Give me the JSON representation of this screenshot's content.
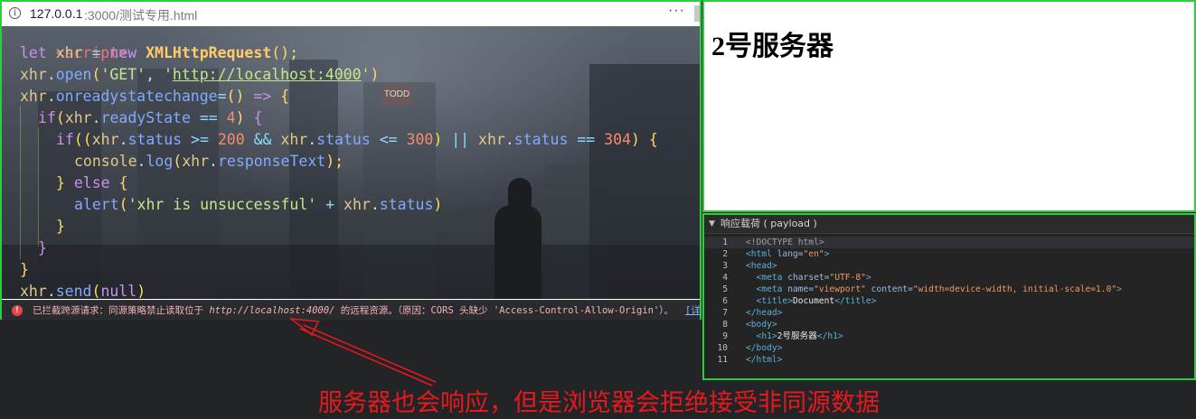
{
  "browser": {
    "url_host": "127.0.0.1",
    "url_rest": ":3000/测试专用.html",
    "info_icon": "i",
    "menu_icon": "···"
  },
  "code": {
    "partial_top": "<script>",
    "lines": [
      {
        "indent": 1,
        "tokens": [
          {
            "t": "let ",
            "c": "kw"
          },
          {
            "t": "xhr",
            "c": "var"
          },
          {
            "t": " = ",
            "c": "op"
          },
          {
            "t": "new ",
            "c": "kw"
          },
          {
            "t": "XMLHttpRequest",
            "c": "cls"
          },
          {
            "t": "();",
            "c": "pn"
          }
        ]
      },
      {
        "indent": 1,
        "tokens": [
          {
            "t": "xhr",
            "c": "var"
          },
          {
            "t": ".",
            "c": "pl"
          },
          {
            "t": "open",
            "c": "fn"
          },
          {
            "t": "(",
            "c": "pn"
          },
          {
            "t": "'GET'",
            "c": "str"
          },
          {
            "t": ", ",
            "c": "pl"
          },
          {
            "t": "'",
            "c": "str"
          },
          {
            "t": "http://localhost:4000",
            "c": "url"
          },
          {
            "t": "'",
            "c": "str"
          },
          {
            "t": ")",
            "c": "pn"
          }
        ]
      },
      {
        "indent": 1,
        "tokens": [
          {
            "t": "xhr",
            "c": "var"
          },
          {
            "t": ".",
            "c": "pl"
          },
          {
            "t": "onreadystatechange",
            "c": "fn"
          },
          {
            "t": "=",
            "c": "op"
          },
          {
            "t": "() ",
            "c": "pn"
          },
          {
            "t": "=> ",
            "c": "kw"
          },
          {
            "t": "{",
            "c": "pn"
          }
        ]
      },
      {
        "indent": 2,
        "tokens": [
          {
            "t": "if",
            "c": "kw"
          },
          {
            "t": "(",
            "c": "pn"
          },
          {
            "t": "xhr",
            "c": "var"
          },
          {
            "t": ".",
            "c": "pl"
          },
          {
            "t": "readyState",
            "c": "fn"
          },
          {
            "t": " == ",
            "c": "op"
          },
          {
            "t": "4",
            "c": "num"
          },
          {
            "t": ") ",
            "c": "pn"
          },
          {
            "t": "{",
            "c": "kw"
          }
        ]
      },
      {
        "indent": 3,
        "tokens": [
          {
            "t": "if",
            "c": "kw"
          },
          {
            "t": "((",
            "c": "pn"
          },
          {
            "t": "xhr",
            "c": "var"
          },
          {
            "t": ".",
            "c": "pl"
          },
          {
            "t": "status",
            "c": "fn"
          },
          {
            "t": " >= ",
            "c": "op"
          },
          {
            "t": "200",
            "c": "num"
          },
          {
            "t": " && ",
            "c": "op"
          },
          {
            "t": "xhr",
            "c": "var"
          },
          {
            "t": ".",
            "c": "pl"
          },
          {
            "t": "status",
            "c": "fn"
          },
          {
            "t": " <= ",
            "c": "op"
          },
          {
            "t": "300",
            "c": "num"
          },
          {
            "t": ") ",
            "c": "pn"
          },
          {
            "t": "|| ",
            "c": "op"
          },
          {
            "t": "xhr",
            "c": "var"
          },
          {
            "t": ".",
            "c": "pl"
          },
          {
            "t": "status",
            "c": "fn"
          },
          {
            "t": " == ",
            "c": "op"
          },
          {
            "t": "304",
            "c": "num"
          },
          {
            "t": ") {",
            "c": "pn"
          }
        ]
      },
      {
        "indent": 4,
        "tokens": [
          {
            "t": "console",
            "c": "var"
          },
          {
            "t": ".",
            "c": "pl"
          },
          {
            "t": "log",
            "c": "fn"
          },
          {
            "t": "(",
            "c": "pn"
          },
          {
            "t": "xhr",
            "c": "var"
          },
          {
            "t": ".",
            "c": "pl"
          },
          {
            "t": "responseText",
            "c": "fn"
          },
          {
            "t": ");",
            "c": "pn"
          }
        ]
      },
      {
        "indent": 3,
        "tokens": [
          {
            "t": "} ",
            "c": "pn"
          },
          {
            "t": "else ",
            "c": "kw"
          },
          {
            "t": "{",
            "c": "pn"
          }
        ]
      },
      {
        "indent": 4,
        "tokens": [
          {
            "t": "alert",
            "c": "fn"
          },
          {
            "t": "(",
            "c": "pn"
          },
          {
            "t": "'xhr is unsuccessful'",
            "c": "str"
          },
          {
            "t": " + ",
            "c": "op"
          },
          {
            "t": "xhr",
            "c": "var"
          },
          {
            "t": ".",
            "c": "pl"
          },
          {
            "t": "status",
            "c": "fn"
          },
          {
            "t": ")",
            "c": "pn"
          }
        ]
      },
      {
        "indent": 3,
        "tokens": [
          {
            "t": "}",
            "c": "pn"
          }
        ]
      },
      {
        "indent": 2,
        "tokens": [
          {
            "t": "}",
            "c": "kw"
          }
        ]
      },
      {
        "indent": 1,
        "tokens": [
          {
            "t": "}",
            "c": "pn"
          }
        ]
      },
      {
        "indent": 1,
        "tokens": [
          {
            "t": "xhr",
            "c": "var"
          },
          {
            "t": ".",
            "c": "pl"
          },
          {
            "t": "send",
            "c": "fn"
          },
          {
            "t": "(",
            "c": "pn"
          },
          {
            "t": "null",
            "c": "kw"
          },
          {
            "t": ")",
            "c": "pn"
          }
        ]
      }
    ],
    "sign_text": "TODD"
  },
  "console_error": {
    "icon": "!",
    "text_before": "已拦截跨源请求：同源策略禁止读取位于 ",
    "url": "http://localhost:4000/",
    "text_after": " 的远程资源。（原因：CORS 头缺少 'Access-Control-Allow-Origin'）。",
    "link": "[详细"
  },
  "page": {
    "heading": "2号服务器"
  },
  "devtools": {
    "section_title": "响应载荷 ( payload )",
    "lines": [
      {
        "n": "1",
        "hl": true,
        "tokens": [
          {
            "t": "<!DOCTYPE html>",
            "c": "d-doc"
          }
        ]
      },
      {
        "n": "2",
        "tokens": [
          {
            "t": "<html ",
            "c": "d-tag"
          },
          {
            "t": "lang=",
            "c": "d-attr"
          },
          {
            "t": "\"en\"",
            "c": "d-val"
          },
          {
            "t": ">",
            "c": "d-tag"
          }
        ]
      },
      {
        "n": "3",
        "tokens": [
          {
            "t": "<head>",
            "c": "d-tag"
          }
        ]
      },
      {
        "n": "4",
        "tokens": [
          {
            "t": "  <meta ",
            "c": "d-tag"
          },
          {
            "t": "charset=",
            "c": "d-attr"
          },
          {
            "t": "\"UTF-8\"",
            "c": "d-val"
          },
          {
            "t": ">",
            "c": "d-tag"
          }
        ]
      },
      {
        "n": "5",
        "tokens": [
          {
            "t": "  <meta ",
            "c": "d-tag"
          },
          {
            "t": "name=",
            "c": "d-attr"
          },
          {
            "t": "\"viewport\"",
            "c": "d-val"
          },
          {
            "t": " content=",
            "c": "d-attr"
          },
          {
            "t": "\"width=device-width, initial-scale=1.0\"",
            "c": "d-val"
          },
          {
            "t": ">",
            "c": "d-tag"
          }
        ]
      },
      {
        "n": "6",
        "tokens": [
          {
            "t": "  <title>",
            "c": "d-tag"
          },
          {
            "t": "Document",
            "c": "d-txt"
          },
          {
            "t": "</title>",
            "c": "d-tag"
          }
        ]
      },
      {
        "n": "7",
        "tokens": [
          {
            "t": "</head>",
            "c": "d-tag"
          }
        ]
      },
      {
        "n": "8",
        "tokens": [
          {
            "t": "<body>",
            "c": "d-tag"
          }
        ]
      },
      {
        "n": "9",
        "tokens": [
          {
            "t": "  <h1>",
            "c": "d-tag"
          },
          {
            "t": "2号服务器",
            "c": "d-txt"
          },
          {
            "t": "</h1>",
            "c": "d-tag"
          }
        ]
      },
      {
        "n": "10",
        "tokens": [
          {
            "t": "</body>",
            "c": "d-tag"
          }
        ]
      },
      {
        "n": "11",
        "tokens": [
          {
            "t": "</html>",
            "c": "d-tag"
          }
        ]
      }
    ]
  },
  "annotation": {
    "caption": "服务器也会响应，但是浏览器会拒绝接受非同源数据"
  },
  "colors": {
    "highlight_border": "#2ecc40",
    "annotation": "#e8191c",
    "error_icon": "#e3474a"
  }
}
